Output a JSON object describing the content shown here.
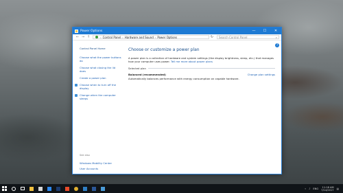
{
  "window": {
    "title": "Power Options",
    "controls": {
      "minimize": "—",
      "maximize": "☐",
      "close": "✕"
    }
  },
  "address": {
    "back": "←",
    "forward": "→",
    "up": "↑",
    "crumbs": [
      "Control Panel",
      "Hardware and Sound",
      "Power Options"
    ],
    "separator": "›",
    "refresh": "↻",
    "search_placeholder": "Search Control Panel"
  },
  "sidebar": {
    "home": "Control Panel Home",
    "items": [
      {
        "label": "Choose what the power buttons do",
        "icon": null
      },
      {
        "label": "Choose what closing the lid does",
        "icon": null
      },
      {
        "label": "Create a power plan",
        "icon": null
      },
      {
        "label": "Choose when to turn off the display",
        "icon": "display-icon"
      },
      {
        "label": "Change when the computer sleeps",
        "icon": "sleep-icon"
      }
    ],
    "see_also": "See also",
    "see_also_items": [
      "Windows Mobility Center",
      "User Accounts"
    ]
  },
  "main": {
    "title": "Choose or customize a power plan",
    "description": "A power plan is a collection of hardware and system settings (like display brightness, sleep, etc.) that manages how your computer uses power.",
    "description_link": "Tell me more about power plans",
    "section_header": "Selected plan",
    "plan_name": "Balanced (recommended)",
    "plan_description": "Automatically balances performance with energy consumption on capable hardware.",
    "change_settings": "Change plan settings",
    "help": "?"
  },
  "taskbar": {
    "tray_text": "ENG",
    "time": "11:18 AM",
    "date": "7/14/2017"
  },
  "colors": {
    "titlebar": "#1e7ad3",
    "link": "#1a5fb4",
    "taskbar": "#101418"
  }
}
